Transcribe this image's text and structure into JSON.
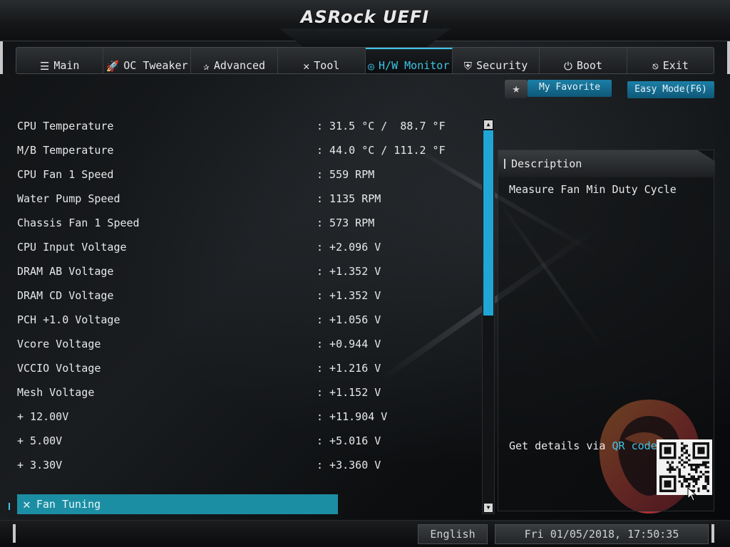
{
  "header": {
    "title": "ASRock UEFI"
  },
  "nav": {
    "tabs": [
      {
        "label": "Main",
        "icon": "list-icon",
        "glyph": "☰"
      },
      {
        "label": "OC Tweaker",
        "icon": "rocket-icon",
        "glyph": "🚀"
      },
      {
        "label": "Advanced",
        "icon": "star-icon",
        "glyph": "✰"
      },
      {
        "label": "Tool",
        "icon": "wrench-screwdriver-icon",
        "glyph": "✕"
      },
      {
        "label": "H/W Monitor",
        "icon": "monitor-icon",
        "glyph": "◎"
      },
      {
        "label": "Security",
        "icon": "shield-icon",
        "glyph": "⛨"
      },
      {
        "label": "Boot",
        "icon": "power-icon",
        "glyph": "⏻"
      },
      {
        "label": "Exit",
        "icon": "exit-icon",
        "glyph": "⎋"
      }
    ],
    "active": "H/W Monitor"
  },
  "toolbar": {
    "favorite_label": "My Favorite",
    "easy_mode_label": "Easy Mode(F6)"
  },
  "monitor": {
    "rows": [
      {
        "label": "CPU Temperature",
        "value": ": 31.5 °C /  88.7 °F"
      },
      {
        "label": "M/B Temperature",
        "value": ": 44.0 °C / 111.2 °F"
      },
      {
        "label": "CPU Fan 1 Speed",
        "value": ": 559 RPM"
      },
      {
        "label": "Water Pump Speed",
        "value": ": 1135 RPM"
      },
      {
        "label": "Chassis Fan 1 Speed",
        "value": ": 573 RPM"
      },
      {
        "label": "CPU Input Voltage",
        "value": ": +2.096 V"
      },
      {
        "label": "DRAM AB Voltage",
        "value": ": +1.352 V"
      },
      {
        "label": "DRAM CD Voltage",
        "value": ": +1.352 V"
      },
      {
        "label": "PCH +1.0 Voltage",
        "value": ": +1.056 V"
      },
      {
        "label": "Vcore Voltage",
        "value": ": +0.944 V"
      },
      {
        "label": "VCCIO Voltage",
        "value": ": +1.216 V"
      },
      {
        "label": "Mesh Voltage",
        "value": ": +1.152 V"
      },
      {
        "label": "+ 12.00V",
        "value": ": +11.904 V"
      },
      {
        "label": "+ 5.00V",
        "value": ": +5.016 V"
      },
      {
        "label": "+ 3.30V",
        "value": ": +3.360 V"
      }
    ],
    "fan_tuning_label": "Fan Tuning"
  },
  "description": {
    "title": "Description",
    "text": "Measure Fan Min Duty Cycle",
    "qr_prefix": "Get details via ",
    "qr_highlight": "QR code"
  },
  "footer": {
    "language": "English",
    "datetime": "Fri 01/05/2018, 17:50:35"
  },
  "colors": {
    "accent": "#3fc4e6",
    "selection": "#1c8ea4",
    "scroll_thumb": "#1fa6d6"
  }
}
